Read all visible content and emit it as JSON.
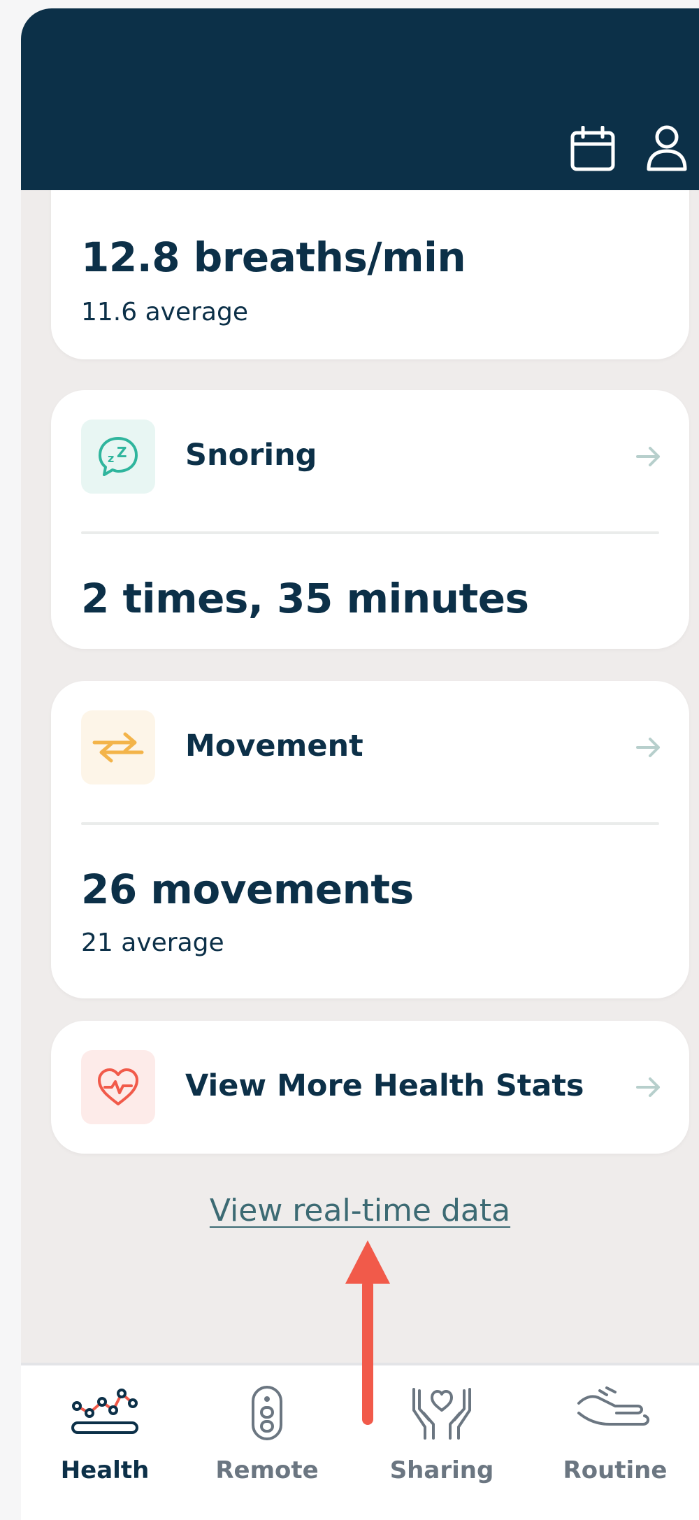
{
  "colors": {
    "navy": "#0c3048",
    "accent_red": "#f15a4a",
    "snoring_teal": "#2fb59d",
    "movement_orange": "#f3b44a",
    "link_teal": "#3c6a73",
    "background": "#efeceb"
  },
  "header": {
    "icons": [
      "calendar-icon",
      "user-icon"
    ]
  },
  "respiration_card": {
    "value": "12.8 breaths/min",
    "average": "11.6 average"
  },
  "snoring_card": {
    "icon": "snoring-chat-icon",
    "title": "Snoring",
    "value": "2 times, 35 minutes"
  },
  "movement_card": {
    "icon": "movement-arrows-icon",
    "title": "Movement",
    "value": "26 movements",
    "average": "21 average"
  },
  "health_stats_card": {
    "icon": "heart-pulse-icon",
    "title": "View More Health Stats"
  },
  "realtime_link": "View real-time data",
  "bottom_nav": {
    "active": "Health",
    "items": [
      {
        "label": "Health",
        "icon": "health-chart-icon"
      },
      {
        "label": "Remote",
        "icon": "remote-icon"
      },
      {
        "label": "Sharing",
        "icon": "sharing-hands-heart-icon"
      },
      {
        "label": "Routine",
        "icon": "routine-hand-icon"
      }
    ]
  }
}
